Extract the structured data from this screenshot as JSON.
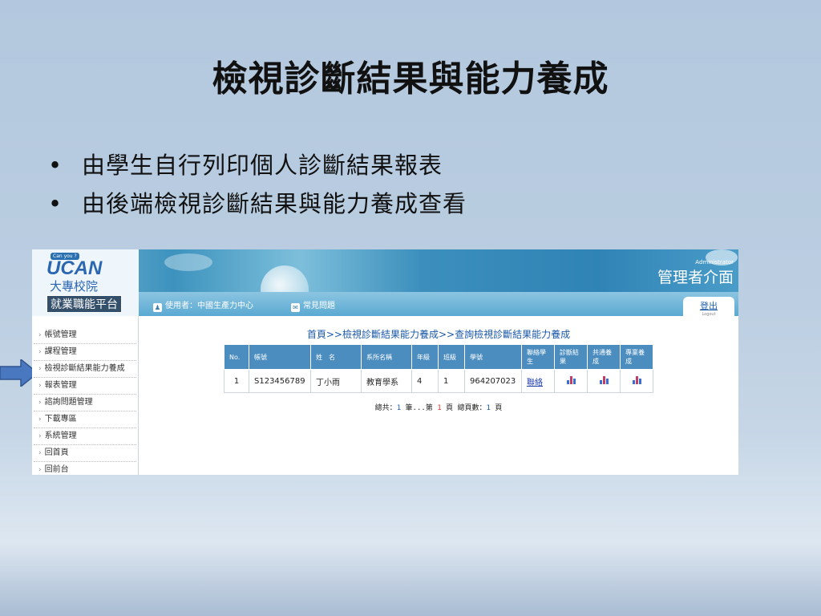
{
  "slide": {
    "title": "檢視診斷結果與能力養成",
    "bullets": [
      "由學生自行列印個人診斷結果報表",
      "由後端檢視診斷結果與能力養成查看"
    ]
  },
  "app": {
    "logo_badge": "Can you ?",
    "logo_name": "UCAN",
    "logo_school": "大專校院",
    "logo_platform": "就業職能平台",
    "admin_en": "Administrator",
    "admin_zh": "管理者介面",
    "nav": {
      "user": "使用者：中國生產力中心",
      "faq": "常見問題"
    },
    "logout": {
      "zh": "登出",
      "en": "Logout"
    },
    "sidebar": [
      "帳號管理",
      "課程管理",
      "檢視診斷結果能力養成",
      "報表管理",
      "諮詢問題管理",
      "下載專區",
      "系統管理",
      "回首頁",
      "回前台"
    ],
    "breadcrumb": "首頁>>檢視診斷結果能力養成>>查詢檢視診斷結果能力養成",
    "table": {
      "headers": [
        "No.",
        "帳號",
        "姓　名",
        "系所名稱",
        "年級",
        "班級",
        "學號",
        "聯絡學生",
        "診斷結果",
        "共通養成",
        "專業養成"
      ],
      "rows": [
        {
          "no": "1",
          "account": "S123456789",
          "name": "丁小雨",
          "dept": "教育學系",
          "grade": "4",
          "class": "1",
          "student_id": "964207023",
          "contact": "聯絡"
        }
      ]
    },
    "pager": {
      "prefix": "總共：",
      "count": "1",
      "mid": " 筆...第 ",
      "page": "1",
      "mid2": " 頁 總頁數：",
      "total": "1",
      "suffix": " 頁"
    }
  },
  "colors": {
    "accent": "#4b8dbf",
    "link": "#1b58a8",
    "arrow": "#4a78c0"
  }
}
